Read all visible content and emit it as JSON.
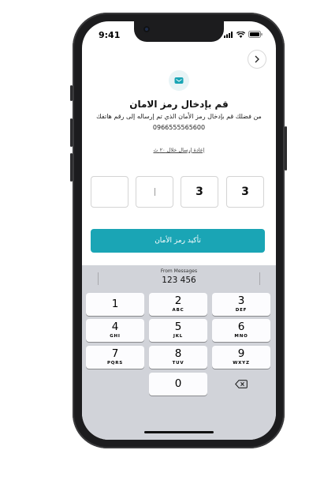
{
  "status_bar": {
    "time": "9:41"
  },
  "header": {
    "back_icon": "chevron-right-icon"
  },
  "logo": {
    "icon": "envelope-icon",
    "color": "#1aa5b5"
  },
  "title": "قم بإدخال رمز الامان",
  "subtitle": "من فضلك قم بإدخال رمز الأمان الذي تم إرساله إلى رقم هاتفك",
  "phone_number": "0966555565600",
  "resend": "إعادة إرسال خلال ٢٠ ث",
  "otp_boxes": [
    "",
    "",
    "3",
    "3"
  ],
  "confirm_label": "تأكيد رمز الأمان",
  "keyboard": {
    "suggestion_label": "From Messages",
    "suggestion_code": "123 456",
    "keys": [
      {
        "num": "1",
        "letters": ""
      },
      {
        "num": "2",
        "letters": "ABC"
      },
      {
        "num": "3",
        "letters": "DEF"
      },
      {
        "num": "4",
        "letters": "GHI"
      },
      {
        "num": "5",
        "letters": "JKL"
      },
      {
        "num": "6",
        "letters": "MNO"
      },
      {
        "num": "7",
        "letters": "PQRS"
      },
      {
        "num": "8",
        "letters": "TUV"
      },
      {
        "num": "9",
        "letters": "WXYZ"
      },
      {
        "num": "0",
        "letters": ""
      }
    ],
    "delete_icon": "backspace-icon"
  },
  "colors": {
    "accent": "#1aa5b5",
    "keyboard_bg": "#d1d3d9",
    "key_bg": "#fcfcfe"
  }
}
